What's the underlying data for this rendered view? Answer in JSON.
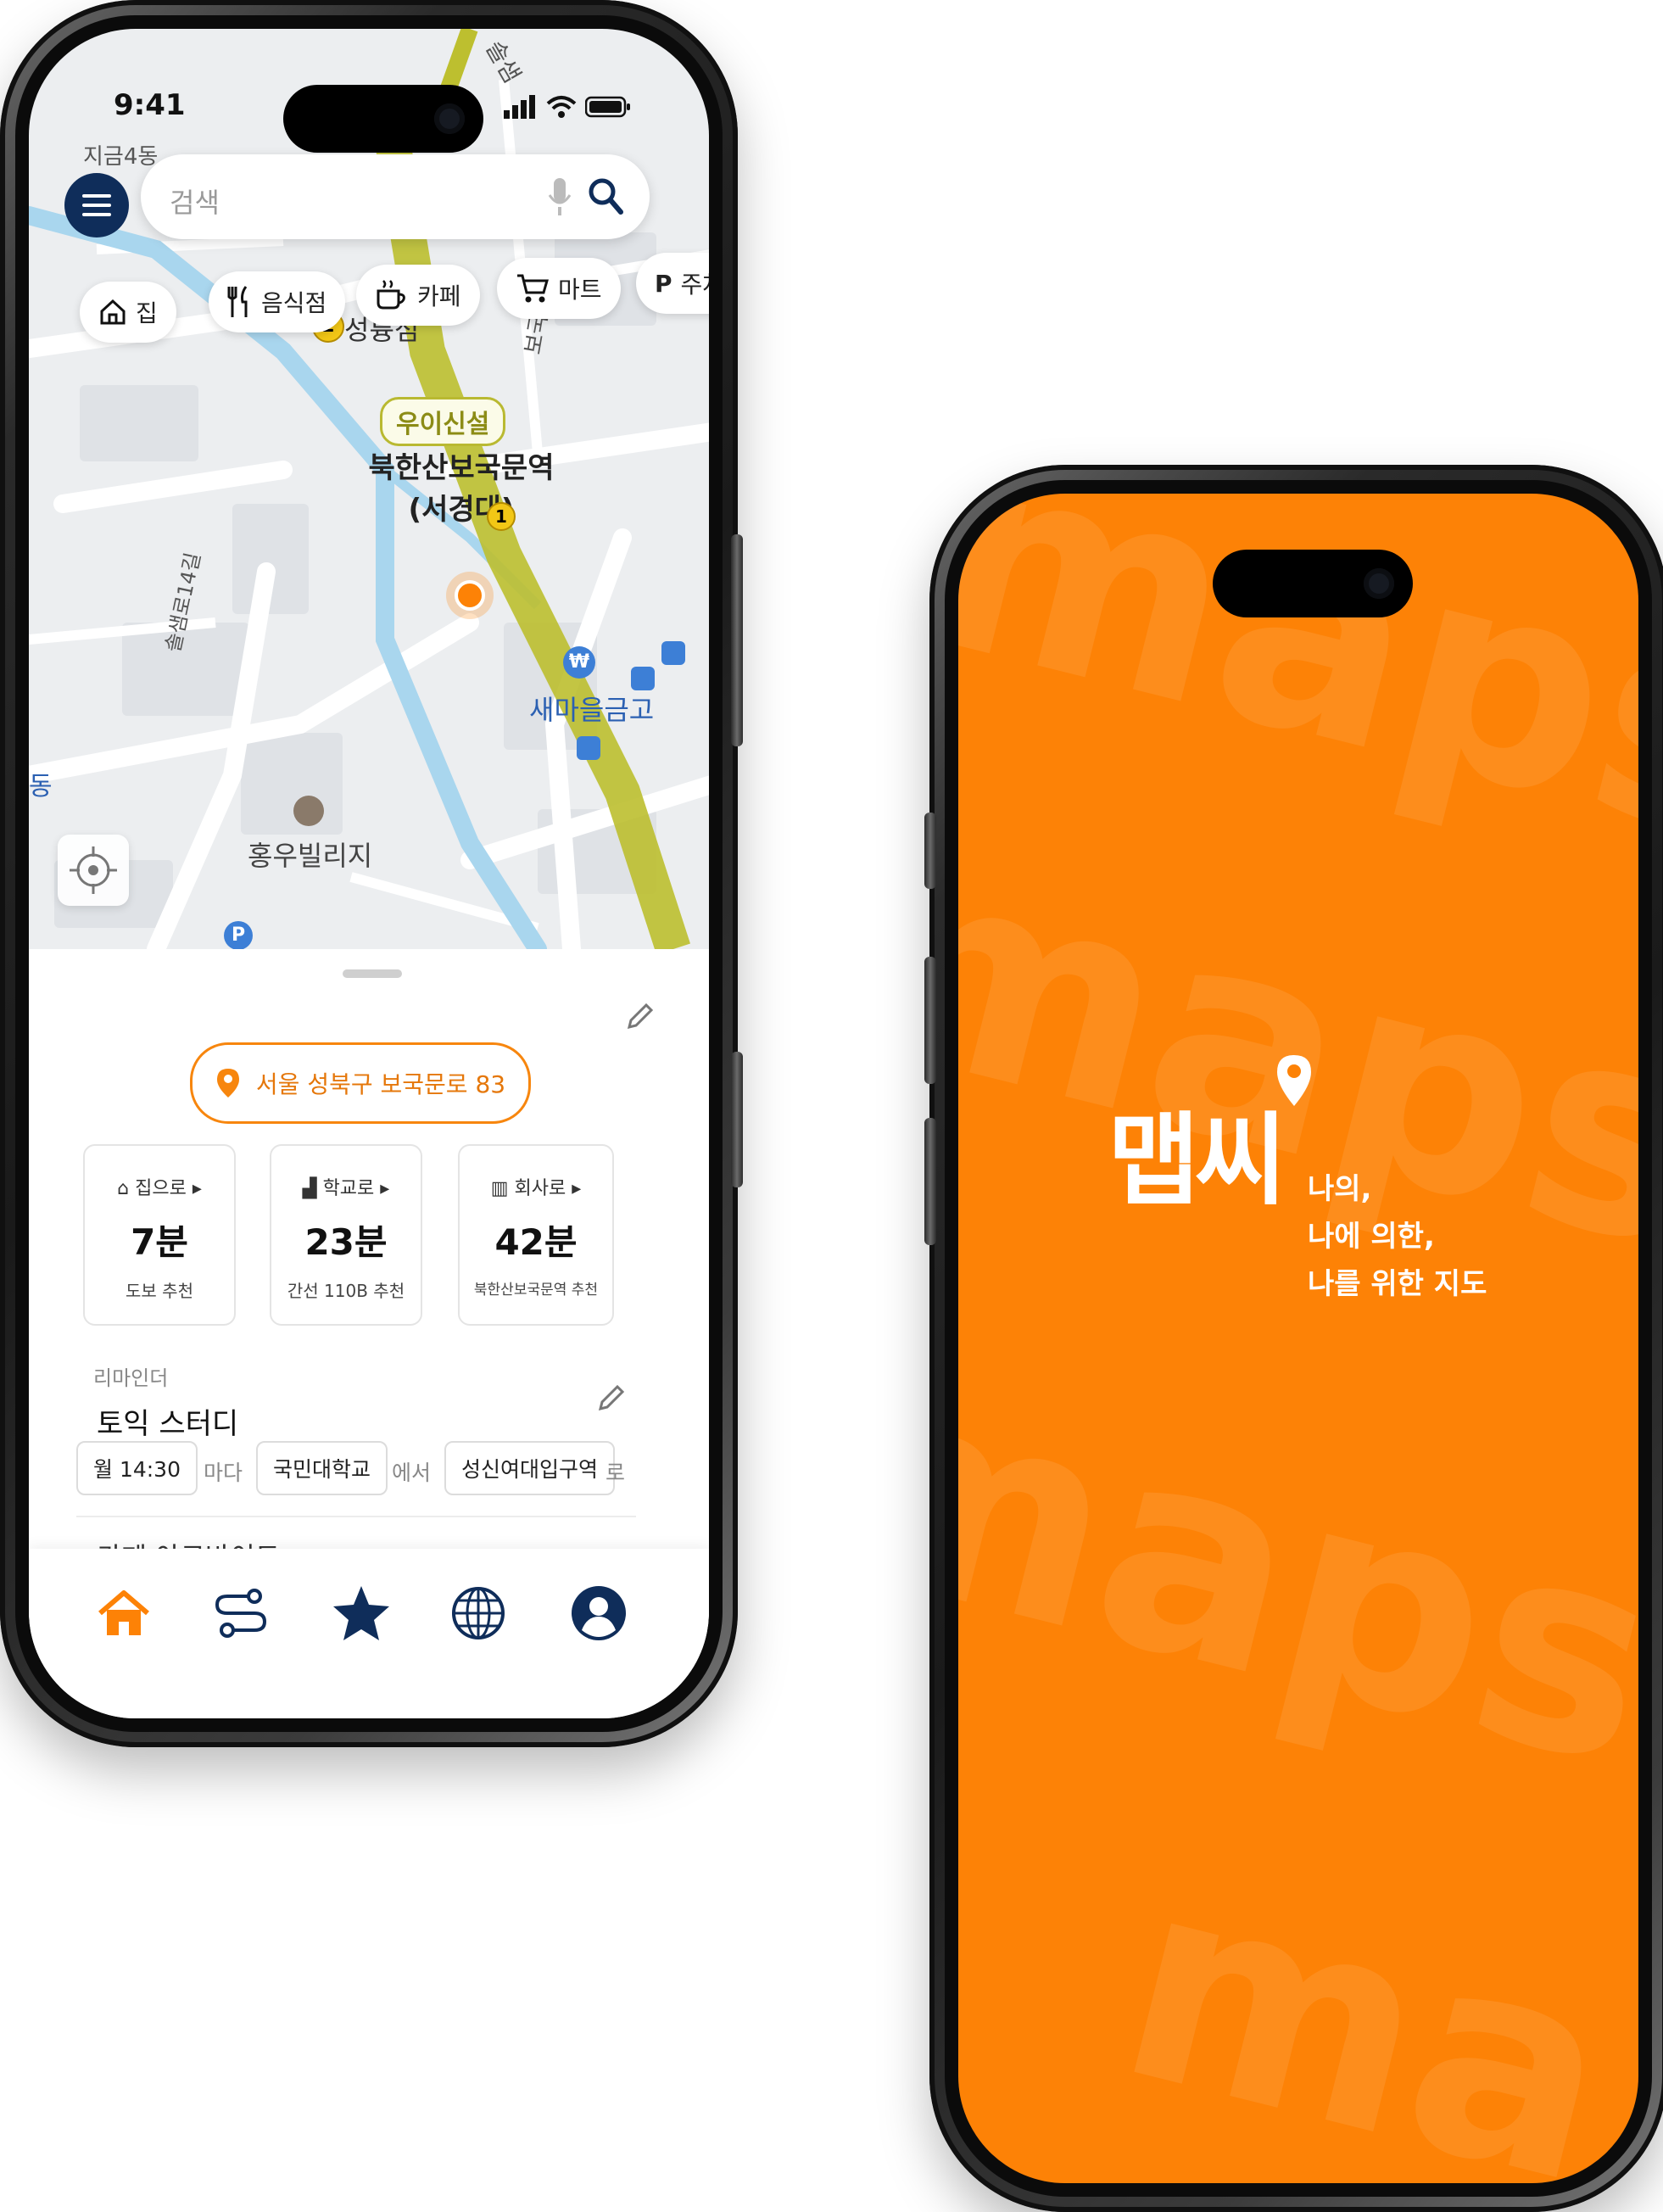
{
  "status_bar": {
    "time": "9:41"
  },
  "search": {
    "placeholder": "검색"
  },
  "categories": [
    {
      "label": "집",
      "icon": "home-icon"
    },
    {
      "label": "음식점",
      "icon": "restaurant-icon"
    },
    {
      "label": "카페",
      "icon": "cafe-icon"
    },
    {
      "label": "마트",
      "icon": "cart-icon"
    },
    {
      "label": "주차",
      "icon": "parking-icon",
      "glyph": "P"
    }
  ],
  "map_labels": {
    "top_road": "솔샘",
    "station_top": "성륭점",
    "line_badge": "우이신설",
    "station_line1": "북한산보국문역",
    "station_line2": "(서경대)",
    "road_right": "보국문로",
    "road_left": "솔샘로14길",
    "bank": "새마을금고",
    "village": "홍우빌리지",
    "left_edge": "동",
    "top_left_place": "지금4동",
    "marker_num_1": "2",
    "marker_num_2": "1",
    "parking_glyph": "P",
    "bank_glyph": "₩"
  },
  "location": {
    "address": "서울 성북구 보국문로 83"
  },
  "cards": [
    {
      "label": "집으로",
      "value": "7분",
      "sub": "도보 추천",
      "icon": "home-icon"
    },
    {
      "label": "학교로",
      "value": "23분",
      "sub": "간선 110B 추천",
      "icon": "school-icon"
    },
    {
      "label": "회사로",
      "value": "42분",
      "sub": "북한산보국문역 추천",
      "icon": "building-icon"
    }
  ],
  "reminder": {
    "section_label": "리마인더",
    "title": "토익 스터디",
    "time": "월 14:30",
    "time_suffix": "마다",
    "from": "국민대학교",
    "from_suffix": "에서",
    "to": "성신여대입구역",
    "to_suffix": "로",
    "next_title": "카페 아르바이트"
  },
  "nav": [
    {
      "name": "home",
      "icon": "home-icon",
      "active": true
    },
    {
      "name": "route",
      "icon": "route-icon"
    },
    {
      "name": "favorites",
      "icon": "star-icon"
    },
    {
      "name": "explore",
      "icon": "globe-icon"
    },
    {
      "name": "profile",
      "icon": "user-icon"
    }
  ],
  "splash": {
    "logo": "맵씨",
    "tagline_1": "나의,",
    "tagline_2": "나에 의한,",
    "tagline_3": "나를 위한 지도",
    "watermark": [
      "mapsee",
      "mapsee",
      "mapsee",
      "ma"
    ]
  },
  "colors": {
    "accent_orange": "#fd8206",
    "navy": "#0f2d5a",
    "line_green": "#b9b931"
  }
}
